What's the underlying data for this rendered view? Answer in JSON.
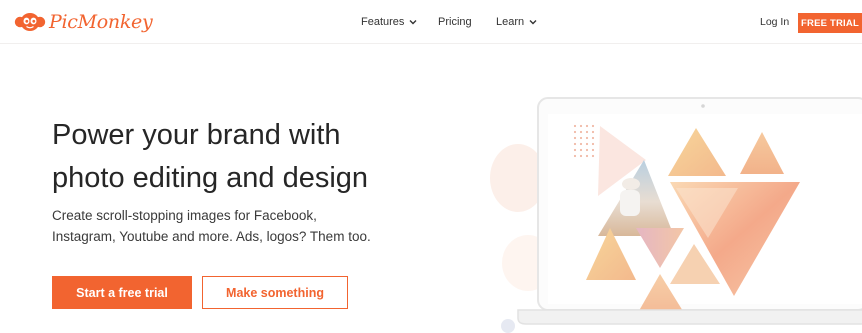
{
  "brand": {
    "name": "PicMonkey",
    "accent_color": "#f26430",
    "logo_icon": "monkey-face-icon"
  },
  "nav": {
    "features_label": "Features",
    "pricing_label": "Pricing",
    "learn_label": "Learn",
    "dropdown_icon": "chevron-down-icon",
    "login_label": "Log In",
    "free_trial_label": "FREE TRIAL"
  },
  "hero": {
    "headline_line1": "Power your brand with",
    "headline_line2": "photo editing and design",
    "sub_line1": "Create scroll-stopping images for Facebook,",
    "sub_line2": "Instagram, Youtube and more. Ads, logos? Them too.",
    "primary_cta": "Start a free trial",
    "secondary_cta": "Make something"
  },
  "illustration": {
    "device": "laptop",
    "content": "triangle photo collage",
    "colors": [
      "#f4c47c",
      "#f3a98a",
      "#efd9a0",
      "#e9b9c8"
    ]
  }
}
